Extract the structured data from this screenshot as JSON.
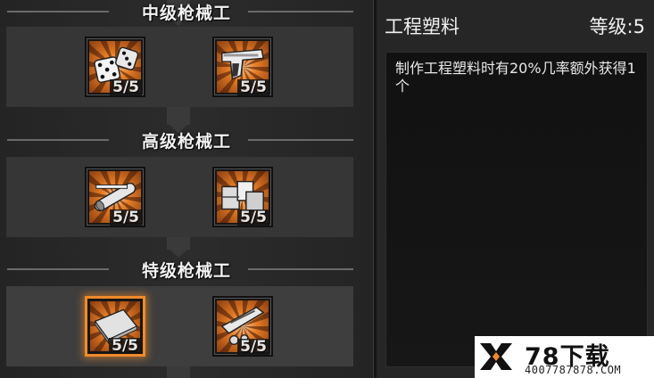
{
  "tiers": [
    {
      "title": "中级枪械工",
      "skills": [
        {
          "id": "dice",
          "level": "5/5"
        },
        {
          "id": "pistol",
          "level": "5/5"
        }
      ]
    },
    {
      "title": "高级枪械工",
      "skills": [
        {
          "id": "pipe",
          "level": "5/5"
        },
        {
          "id": "crates",
          "level": "5/5"
        }
      ]
    },
    {
      "title": "特级枪械工",
      "skills": [
        {
          "id": "plastic-sheet",
          "level": "5/5",
          "selected": true
        },
        {
          "id": "gun-parts",
          "level": "5/5"
        }
      ]
    }
  ],
  "detail": {
    "title": "工程塑料",
    "level": "等级:5",
    "description": "制作工程塑料时有20%几率额外获得1个"
  },
  "watermark": {
    "name": "78下载",
    "url": "4007787878.COM"
  },
  "colors": {
    "accent": "#f08a2a",
    "icon_orange": "#e67d26"
  }
}
